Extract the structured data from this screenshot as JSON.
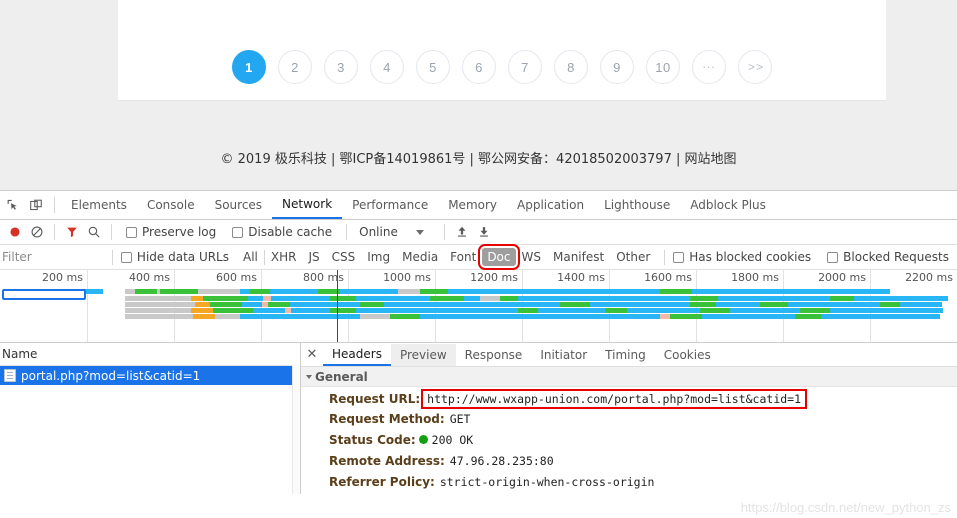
{
  "webpage": {
    "pagination": {
      "items": [
        {
          "label": "1",
          "active": true
        },
        {
          "label": "2",
          "active": false
        },
        {
          "label": "3",
          "active": false
        },
        {
          "label": "4",
          "active": false
        },
        {
          "label": "5",
          "active": false
        },
        {
          "label": "6",
          "active": false
        },
        {
          "label": "7",
          "active": false
        },
        {
          "label": "8",
          "active": false
        },
        {
          "label": "9",
          "active": false
        },
        {
          "label": "10",
          "active": false
        },
        {
          "label": "...",
          "active": false
        },
        {
          "label": "> >",
          "active": false
        }
      ]
    },
    "footer": {
      "text": "© 2019 极乐科技 | 鄂ICP备14019861号 | 鄂公网安备：42018502003797 | 网站地图"
    }
  },
  "devtools": {
    "main_tabs": [
      {
        "label": "Elements",
        "selected": false
      },
      {
        "label": "Console",
        "selected": false
      },
      {
        "label": "Sources",
        "selected": false
      },
      {
        "label": "Network",
        "selected": true
      },
      {
        "label": "Performance",
        "selected": false
      },
      {
        "label": "Memory",
        "selected": false
      },
      {
        "label": "Application",
        "selected": false
      },
      {
        "label": "Lighthouse",
        "selected": false
      },
      {
        "label": "Adblock Plus",
        "selected": false
      }
    ],
    "toolbar": {
      "record_icon": "record-icon",
      "clear_icon": "clear-icon",
      "filter_icon": "filter-icon",
      "search_icon": "search-icon",
      "preserve_log_label": "Preserve log",
      "preserve_log_checked": false,
      "disable_cache_label": "Disable cache",
      "disable_cache_checked": false,
      "throttle_value": "Online",
      "upload_icon": "upload-icon",
      "download_icon": "download-icon"
    },
    "filterbar": {
      "filter_placeholder": "Filter",
      "filter_value": "",
      "hide_data_urls_label": "Hide data URLs",
      "hide_data_urls_checked": false,
      "types": [
        {
          "label": "All",
          "selected": false
        },
        {
          "label": "XHR",
          "selected": false
        },
        {
          "label": "JS",
          "selected": false
        },
        {
          "label": "CSS",
          "selected": false
        },
        {
          "label": "Img",
          "selected": false
        },
        {
          "label": "Media",
          "selected": false
        },
        {
          "label": "Font",
          "selected": false
        },
        {
          "label": "Doc",
          "selected": true
        },
        {
          "label": "WS",
          "selected": false
        },
        {
          "label": "Manifest",
          "selected": false
        },
        {
          "label": "Other",
          "selected": false
        }
      ],
      "has_blocked_cookies_label": "Has blocked cookies",
      "has_blocked_cookies_checked": false,
      "blocked_requests_label": "Blocked Requests",
      "blocked_requests_checked": false
    },
    "overview": {
      "ticks": [
        "200 ms",
        "400 ms",
        "600 ms",
        "800 ms",
        "1000 ms",
        "1200 ms",
        "1400 ms",
        "1600 ms",
        "1800 ms",
        "2000 ms",
        "2200 ms"
      ]
    },
    "requests": {
      "column_header": "Name",
      "rows": [
        {
          "name": "portal.php?mod=list&catid=1",
          "selected": true
        }
      ]
    },
    "detail": {
      "tabs": [
        {
          "label": "Headers",
          "selected": true
        },
        {
          "label": "Preview",
          "selected": false
        },
        {
          "label": "Response",
          "selected": false
        },
        {
          "label": "Initiator",
          "selected": false
        },
        {
          "label": "Timing",
          "selected": false
        },
        {
          "label": "Cookies",
          "selected": false
        }
      ],
      "section_title": "General",
      "fields": [
        {
          "key": "Request URL:",
          "value": "http://www.wxapp-union.com/portal.php?mod=list&catid=1",
          "highlight": true
        },
        {
          "key": "Request Method:",
          "value": "GET",
          "highlight": false
        },
        {
          "key": "Status Code:",
          "value": "200 OK",
          "highlight": false,
          "status_dot": true
        },
        {
          "key": "Remote Address:",
          "value": "47.96.28.235:80",
          "highlight": false
        },
        {
          "key": "Referrer Policy:",
          "value": "strict-origin-when-cross-origin",
          "highlight": false
        }
      ]
    }
  },
  "watermark": {
    "text": "https://blog.csdn.net/new_python_zs"
  },
  "colors": {
    "accent": "#1a73e8",
    "page_active": "#22a7f0",
    "record": "#d93025",
    "highlight_box": "#e60000",
    "status_ok": "#12a012",
    "selected_row": "#1a73e8"
  }
}
